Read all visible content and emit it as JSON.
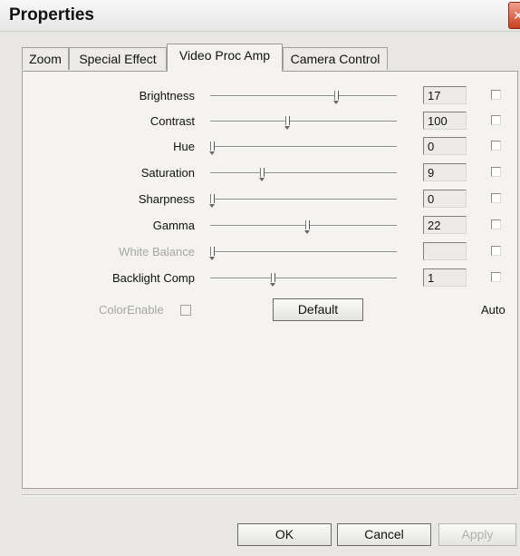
{
  "window": {
    "title": "Properties",
    "close_glyph": "✕"
  },
  "tabs": [
    {
      "label": "Zoom",
      "active": false
    },
    {
      "label": "Special Effect",
      "active": false
    },
    {
      "label": "Video Proc Amp",
      "active": true
    },
    {
      "label": "Camera Control",
      "active": false
    }
  ],
  "controls": [
    {
      "label": "Brightness",
      "value": "17",
      "slider_position": 0.68,
      "auto": false,
      "enabled": true
    },
    {
      "label": "Contrast",
      "value": "100",
      "slider_position": 0.41,
      "auto": false,
      "enabled": true
    },
    {
      "label": "Hue",
      "value": "0",
      "slider_position": 0.0,
      "auto": false,
      "enabled": true
    },
    {
      "label": "Saturation",
      "value": "9",
      "slider_position": 0.27,
      "auto": false,
      "enabled": true
    },
    {
      "label": "Sharpness",
      "value": "0",
      "slider_position": 0.0,
      "auto": false,
      "enabled": true
    },
    {
      "label": "Gamma",
      "value": "22",
      "slider_position": 0.52,
      "auto": false,
      "enabled": true
    },
    {
      "label": "White Balance",
      "value": "",
      "slider_position": 0.0,
      "auto": false,
      "enabled": false
    },
    {
      "label": "Backlight Comp",
      "value": "1",
      "slider_position": 0.33,
      "auto": false,
      "enabled": true
    }
  ],
  "color_enable": {
    "label": "ColorEnable",
    "checked": false,
    "enabled": false
  },
  "default_button": "Default",
  "auto_label": "Auto",
  "footer": {
    "ok": "OK",
    "cancel": "Cancel",
    "apply": "Apply"
  }
}
